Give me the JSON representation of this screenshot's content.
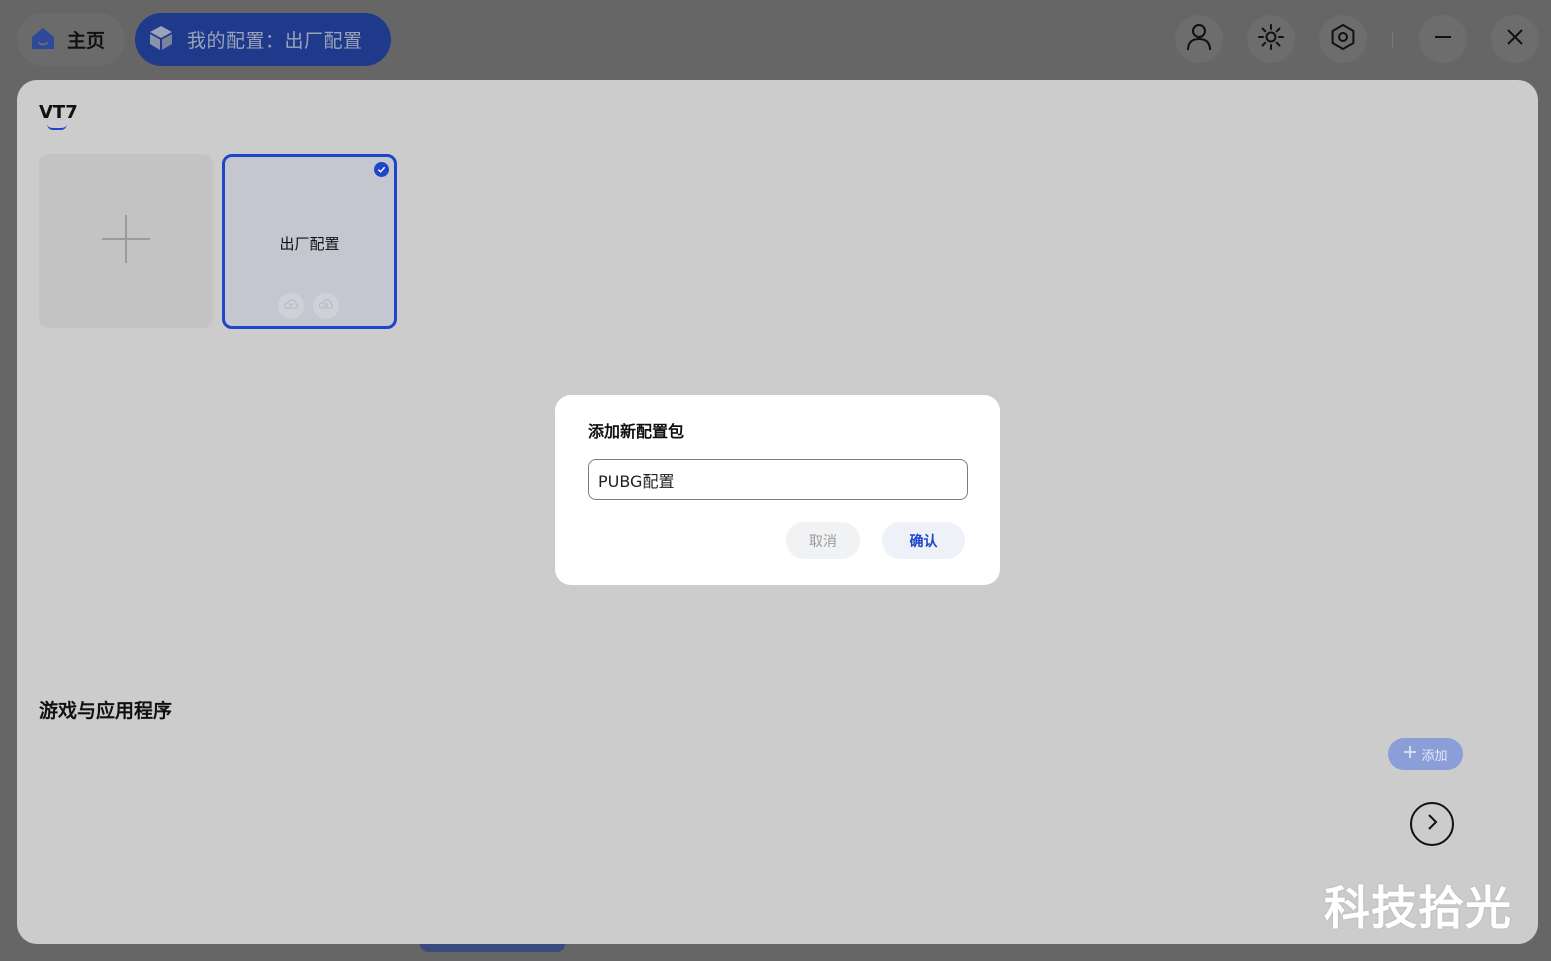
{
  "topbar": {
    "home_label": "主页",
    "config_label": "我的配置：出厂配置",
    "icons": [
      "home-icon",
      "cube-icon",
      "user-icon",
      "brightness-icon",
      "settings-hex-icon",
      "minimize-icon",
      "close-icon"
    ]
  },
  "device": {
    "name": "VT7"
  },
  "profiles": [
    {
      "name": "出厂配置",
      "selected": true
    }
  ],
  "apps_section": {
    "title": "游戏与应用程序",
    "add_label": "添加"
  },
  "dialog": {
    "title": "添加新配置包",
    "input_value": "PUBG配置",
    "cancel_label": "取消",
    "confirm_label": "确认"
  },
  "watermark": "科技拾光",
  "colors": {
    "accent": "#1e46c8",
    "accent_dark": "#1f3a8a",
    "overlay_bg": "#666666",
    "panel_bg": "#cccccc"
  }
}
